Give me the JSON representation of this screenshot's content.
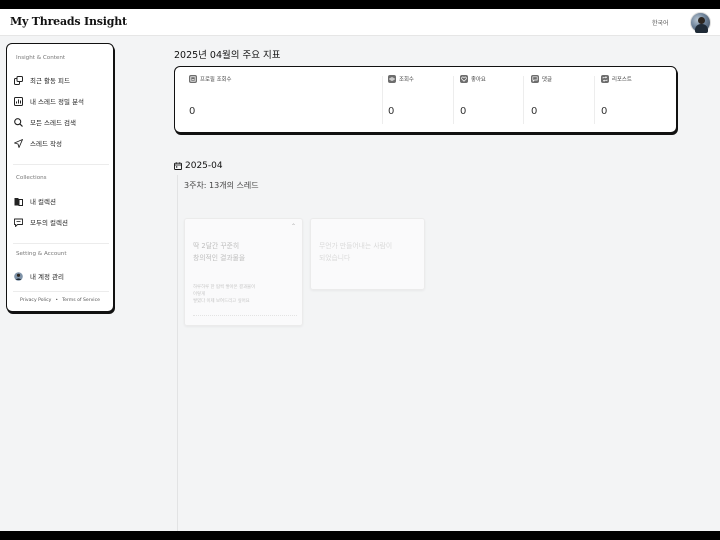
{
  "header": {
    "brand": "My Threads Insight",
    "language": "한국어"
  },
  "sidebar": {
    "sections": [
      {
        "title": "Insight & Content"
      },
      {
        "title": "Collections"
      },
      {
        "title": "Setting & Account"
      }
    ],
    "items": [
      {
        "label": "최근 활동 피드",
        "icon": "feed-icon"
      },
      {
        "label": "내 스레드 정밀 분석",
        "icon": "analytics-icon"
      },
      {
        "label": "모든 스레드 검색",
        "icon": "search-icon"
      },
      {
        "label": "스레드 작성",
        "icon": "send-icon"
      },
      {
        "label": "내 컬렉션",
        "icon": "collection-icon"
      },
      {
        "label": "모두의 컬렉션",
        "icon": "shared-collection-icon"
      },
      {
        "label": "내 계정 관리",
        "icon": "account-avatar-icon"
      }
    ],
    "footer": {
      "privacy": "Privacy Policy",
      "separator": "•",
      "terms": "Terms of Service"
    }
  },
  "main": {
    "title": "2025년 04월의 주요 지표",
    "metrics": [
      {
        "label": "프로필 조회수",
        "value": "0",
        "icon": "profile-views-icon"
      },
      {
        "label": "조회수",
        "value": "0",
        "icon": "views-icon"
      },
      {
        "label": "좋아요",
        "value": "0",
        "icon": "likes-icon"
      },
      {
        "label": "댓글",
        "value": "0",
        "icon": "comments-icon"
      },
      {
        "label": "리포스트",
        "value": "0",
        "icon": "reposts-icon"
      }
    ],
    "date": "2025-04",
    "week_label": "3주차: 13개의 스레드",
    "cards": [
      {
        "title_line1": "딱 2달간 꾸준히",
        "title_line2": "창의적인 결과물을",
        "body_line1": "하루하루 한 땀씩 쌓아온 결과물이",
        "body_line2": "이렇게",
        "body_line3": "쌓였다 이제 보여드리고 싶어요"
      },
      {
        "title_line1": "무언가 만들어내는 사람이",
        "title_line2": "되었습니다"
      }
    ]
  },
  "colors": {
    "background": "#f3f4f5",
    "card_border": "#111111",
    "text_primary": "#111111"
  }
}
